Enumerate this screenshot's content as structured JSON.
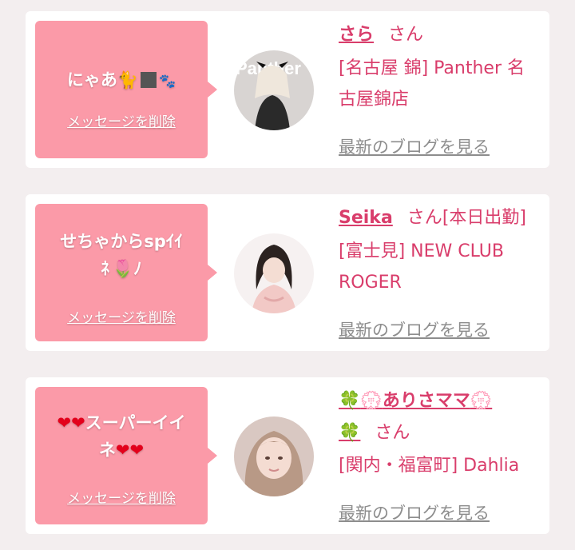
{
  "theme": {
    "bubble_color": "#fb9aa8",
    "accent_color": "#d93d6b",
    "link_gray": "#8d8d8d",
    "background": "#f3eeef"
  },
  "cards": [
    {
      "message_text": "にゃあ",
      "message_emojis": [
        "cat-face",
        "black-square",
        "paw-prints"
      ],
      "delete_label": "メッセージを削除",
      "name": "さら",
      "honorific": "さん",
      "tag": "",
      "store_line1": "[名古屋 錦] Panther 名",
      "store_line2": "古屋錦店",
      "avatar_text": "Panther",
      "blog_label": "最新のブログを見る"
    },
    {
      "message_line1": "せちゃからspｲｲ",
      "message_line2": "ﾈ",
      "message_emojis": [
        "tulip"
      ],
      "delete_label": "メッセージを削除",
      "name": "Seika",
      "honorific": "さん",
      "tag": "[本日出勤]",
      "store_line1": "[富士見] NEW CLUB",
      "store_line2": "ROGER",
      "blog_label": "最新のブログを見る"
    },
    {
      "message_line1": "スーパーイイ",
      "message_line2": "ネ",
      "message_emojis": [
        "red-heart",
        "red-heart"
      ],
      "delete_label": "メッセージを削除",
      "name_prefix_symbols": "🍀💮",
      "name": "ありさママ",
      "name_suffix_symbols": "💮",
      "name_line2_symbol": "🍀",
      "honorific": "さん",
      "store_line1": "[関内・福富町] Dahlia",
      "blog_label": "最新のブログを見る"
    }
  ]
}
